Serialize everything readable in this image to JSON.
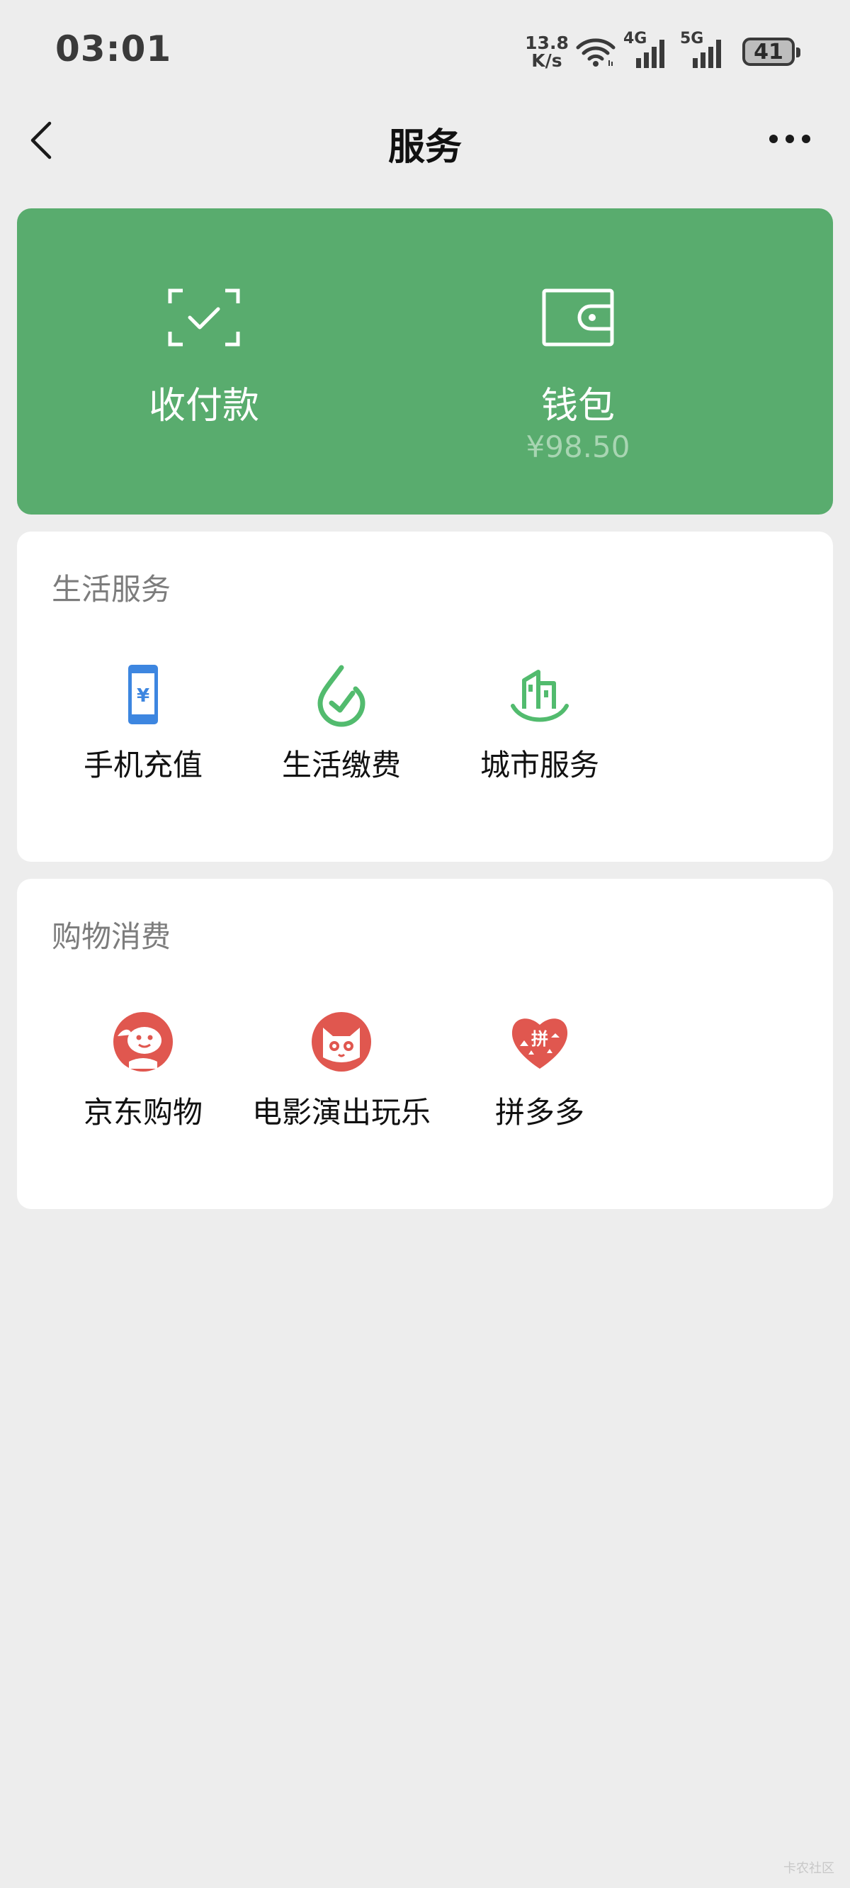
{
  "status_bar": {
    "time": "03:01",
    "net_speed_value": "13.8",
    "net_speed_unit": "K/s",
    "signal_1_label": "4G",
    "signal_2_label": "5G",
    "battery": "41"
  },
  "nav": {
    "title": "服务",
    "back_icon": "chevron-left-icon",
    "more_icon": "more-dots-icon"
  },
  "top_card": {
    "color": "#59ac6e",
    "pay": {
      "label": "收付款",
      "icon": "scan-check-icon"
    },
    "wallet": {
      "label": "钱包",
      "balance": "¥98.50",
      "icon": "wallet-icon"
    }
  },
  "sections": [
    {
      "title": "生活服务",
      "items": [
        {
          "label": "手机充值",
          "icon": "mobile-recharge-icon"
        },
        {
          "label": "生活缴费",
          "icon": "utility-payment-icon"
        },
        {
          "label": "城市服务",
          "icon": "city-service-icon"
        }
      ]
    },
    {
      "title": "购物消费",
      "items": [
        {
          "label": "京东购物",
          "icon": "jd-dog-icon"
        },
        {
          "label": "电影演出玩乐",
          "icon": "maoyan-cat-icon"
        },
        {
          "label": "拼多多",
          "icon": "pinduoduo-heart-icon"
        }
      ]
    }
  ],
  "watermark": "卡农社区"
}
